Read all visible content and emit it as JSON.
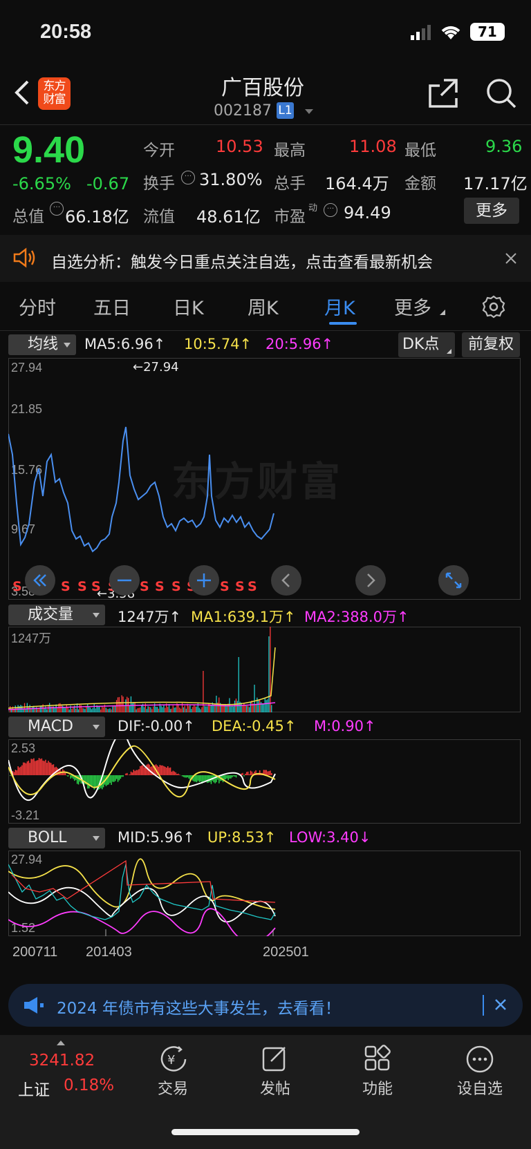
{
  "status_bar": {
    "time": "20:58",
    "battery": "71"
  },
  "header": {
    "title": "广百股份",
    "code": "002187",
    "level": "L1",
    "logo_text": "东方财富"
  },
  "quote": {
    "price": "9.40",
    "change_pct": "-6.65%",
    "change": "-0.67",
    "open_label": "今开",
    "open": "10.53",
    "high_label": "最高",
    "high": "11.08",
    "low_label": "最低",
    "low": "9.36",
    "turnover_label": "换手",
    "turnover": "31.80%",
    "volume_label": "总手",
    "volume": "164.4万",
    "amount_label": "金额",
    "amount": "17.17亿",
    "mktcap_label": "总值",
    "mktcap": "66.18亿",
    "float_label": "流值",
    "float": "48.61亿",
    "pe_label": "市盈",
    "pe_sup": "动",
    "pe": "94.49",
    "more_button": "更多"
  },
  "notice": {
    "text": "自选分析：触发今日重点关注自选，点击查看最新机会"
  },
  "tabs": [
    "分时",
    "五日",
    "日K",
    "周K",
    "月K",
    "更多"
  ],
  "active_tab": "月K",
  "main_chart": {
    "indicator_select": "均线",
    "ma5": "MA5:6.96↑",
    "ma10": "10:5.74↑",
    "ma20": "20:5.96↑",
    "dk_button": "DK点",
    "adjust_button": "前复权",
    "y_labels": [
      "27.94",
      "21.85",
      "15.76",
      "9.67",
      "3.58"
    ],
    "max_marker": "←27.94",
    "min_marker": "←3.58",
    "watermark": "东方财富",
    "s_markers": [
      "S",
      "S",
      "S",
      "S",
      "S",
      "S",
      "S",
      "S",
      "S",
      "S",
      "S",
      "S",
      "S",
      "S",
      "S",
      "S",
      "S"
    ]
  },
  "volume_chart": {
    "indicator_select": "成交量",
    "value": "1247万↑",
    "ma1": "MA1:639.1万↑",
    "ma2": "MA2:388.0万↑",
    "y_label": "1247万"
  },
  "macd_chart": {
    "indicator_select": "MACD",
    "dif": "DIF:-0.00↑",
    "dea": "DEA:-0.45↑",
    "m": "M:0.90↑",
    "y_top": "2.53",
    "y_bottom": "-3.21"
  },
  "boll_chart": {
    "indicator_select": "BOLL",
    "mid": "MID:5.96↑",
    "up": "UP:8.53↑",
    "low": "LOW:3.40↓",
    "y_top": "27.94",
    "y_bottom": "1.52",
    "x_labels": [
      "200711",
      "201403",
      "202501"
    ]
  },
  "banner": {
    "text": "2024 年债市有这些大事发生，去看看！"
  },
  "bottom_nav": {
    "index_value": "3241.82",
    "index_name": "上证",
    "index_change": "0.18%",
    "items": [
      "交易",
      "发帖",
      "功能",
      "设自选"
    ]
  },
  "colors": {
    "up": "#ff3b3b",
    "down": "#2bd94a",
    "price_line": "#4a8ff0",
    "ma_yellow": "#f5e14a",
    "ma_magenta": "#ff3cff",
    "accent_blue": "#3a8cf0"
  }
}
